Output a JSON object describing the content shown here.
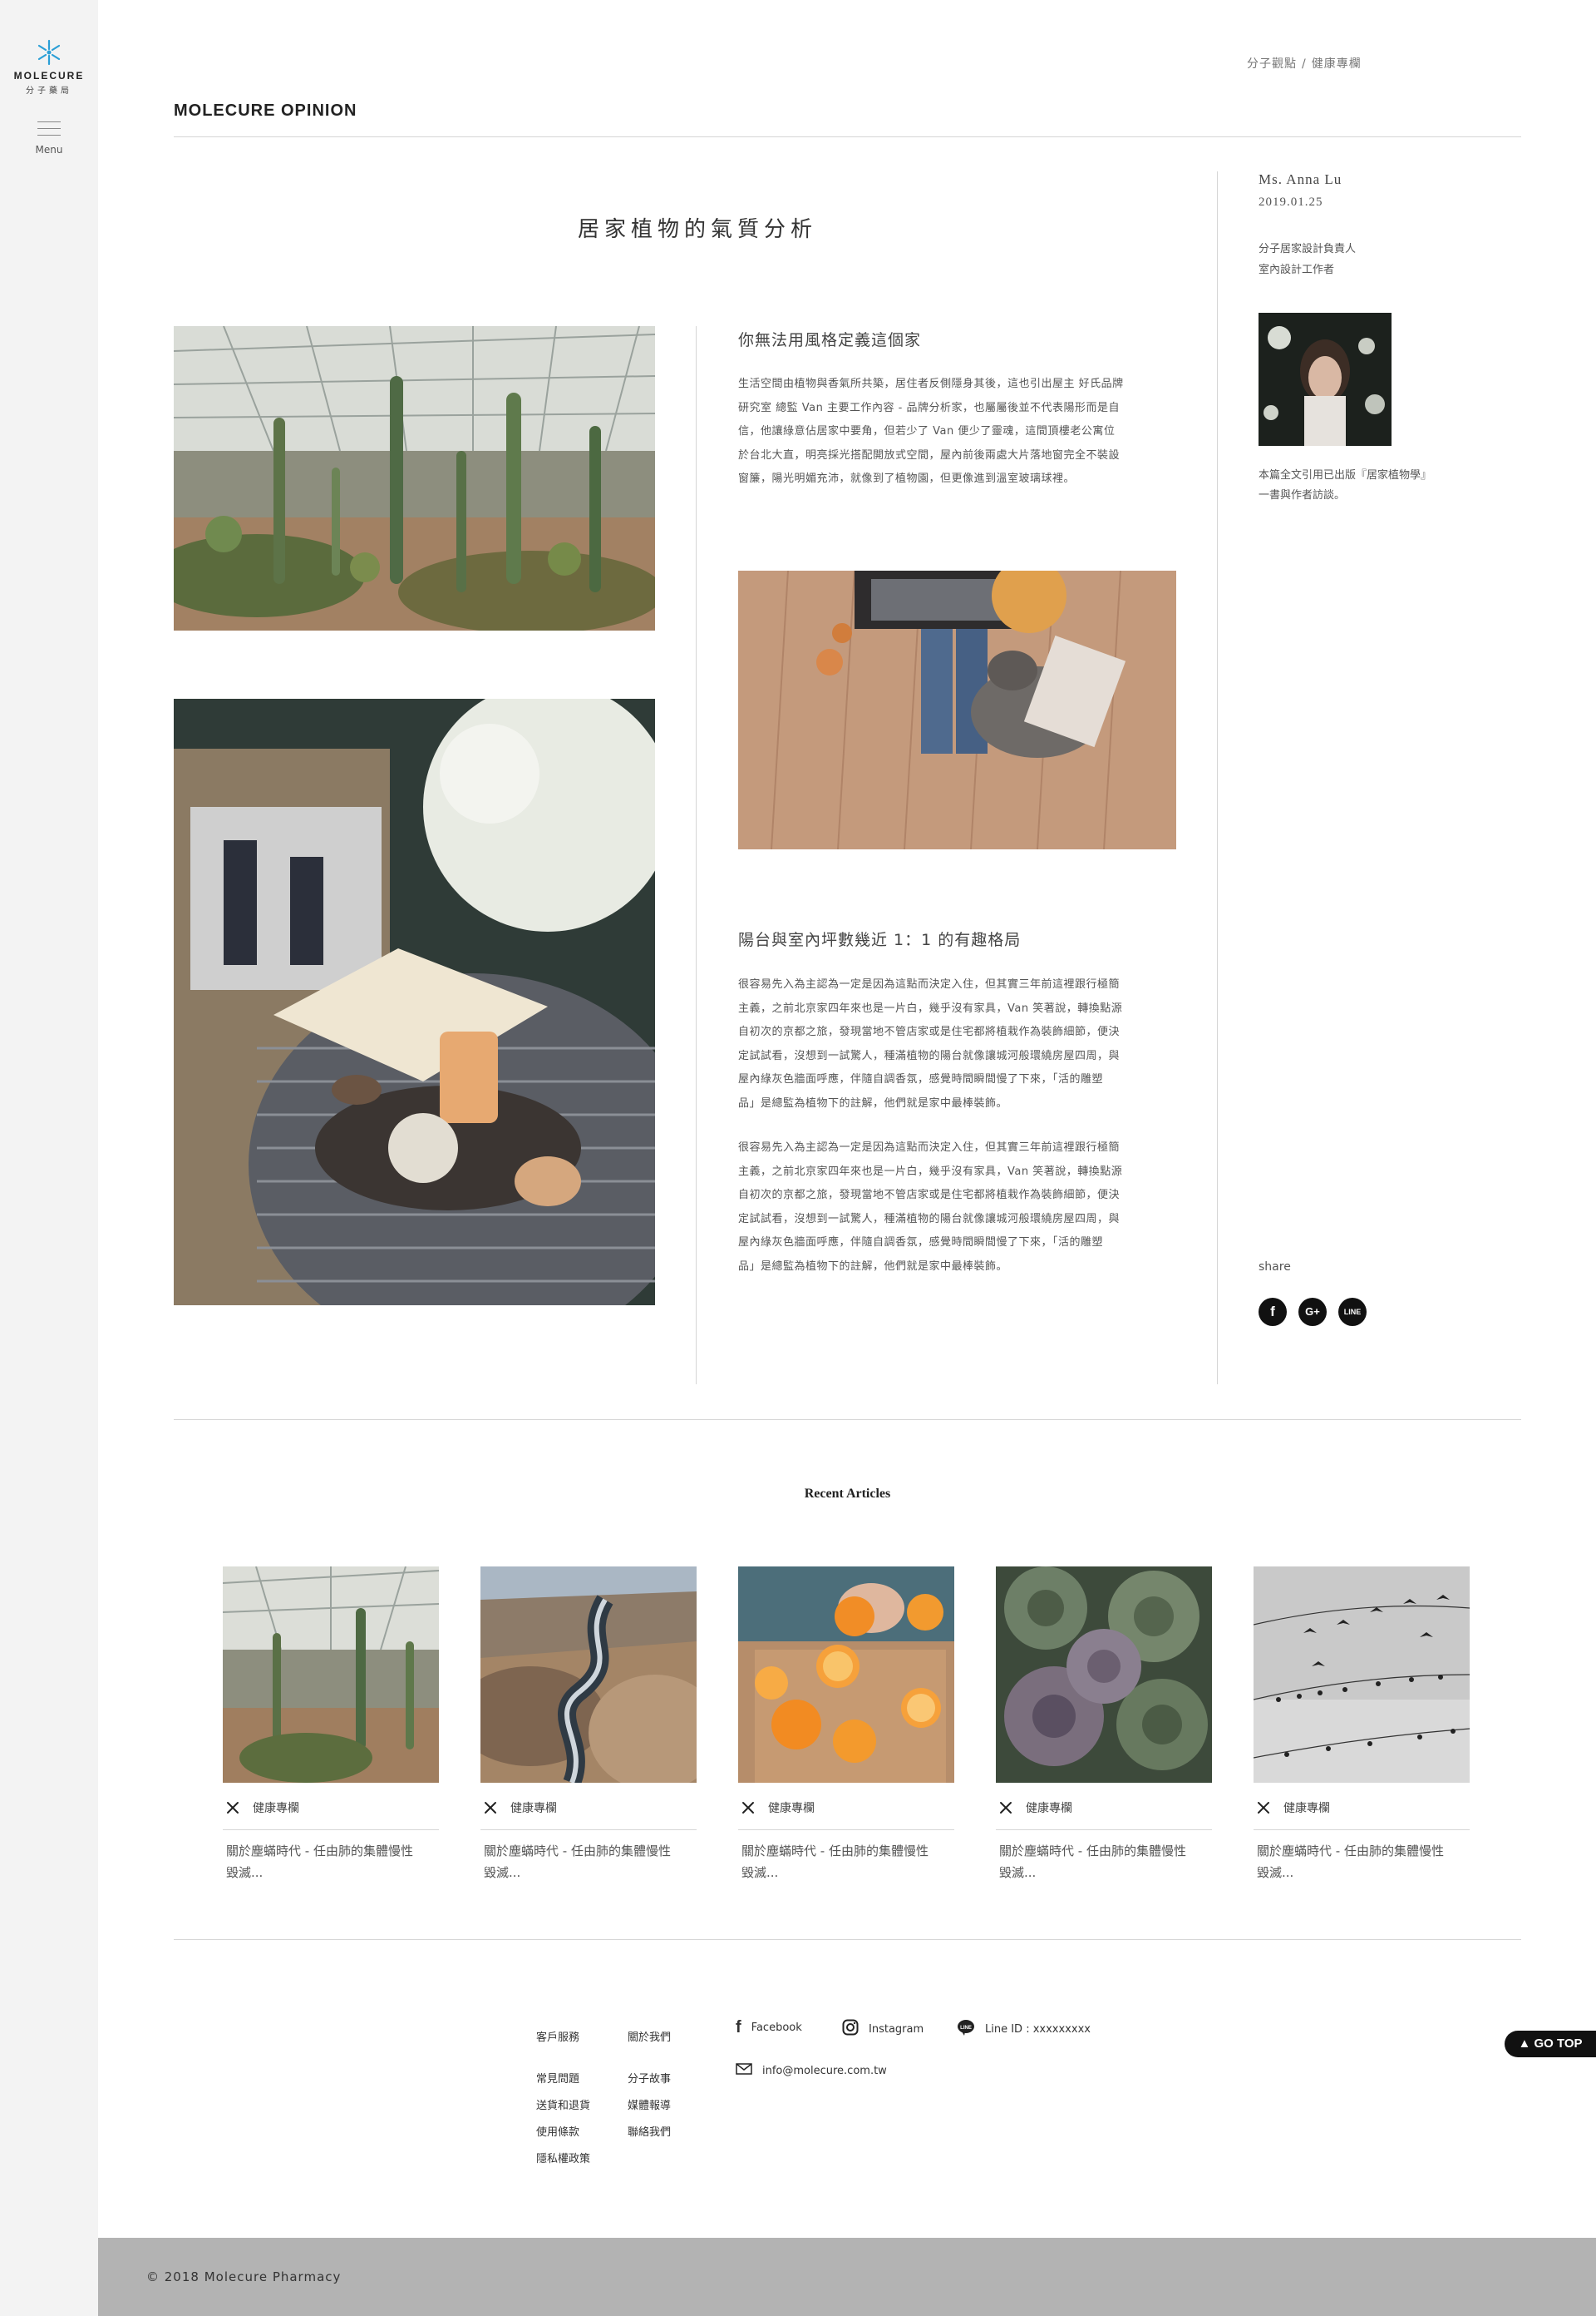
{
  "sidebar": {
    "logo_name": "MOLECURE",
    "logo_sub": "分子藥局",
    "menu_label": "Menu"
  },
  "breadcrumb": [
    "分子觀點",
    "/",
    "健康專欄"
  ],
  "site_title": "MOLECURE OPINION",
  "article": {
    "title": "居家植物的氣質分析",
    "section1": {
      "heading": "你無法用風格定義這個家",
      "lines": [
        "生活空間由植物與香氣所共築，居住者反側隱身其後，這也引出屋主 好氏品牌",
        "研究室 總監 Van 主要工作內容 - 品牌分析家，也屬屬後並不代表陽形而是自",
        "信，他讓綠意佔居家中要角，但若少了 Van 便少了靈魂，這間頂樓老公寓位",
        "於台北大直，明亮採光搭配開放式空間，屋內前後兩處大片落地窗完全不裝設",
        "窗簾，陽光明媚充沛，就像到了植物園，但更像進到溫室玻璃球裡。"
      ]
    },
    "section2": {
      "heading": "陽台與室內坪數幾近 1：1 的有趣格局",
      "para1": [
        "很容易先入為主認為一定是因為這點而決定入住，但其實三年前這裡跟行極簡",
        "主義，之前北京家四年來也是一片白，幾乎沒有家具，Van 笑著說，轉換點源",
        "自初次的京都之旅，發現當地不管店家或是住宅都將植栽作為裝飾細節，便決",
        "定試試看，沒想到一試驚人，種滿植物的陽台就像讓城河般環繞房屋四周，與",
        "屋內綠灰色牆面呼應，伴隨自調香氛，感覺時間瞬間慢了下來，「活的雕塑",
        "品」是總監為植物下的註解，他們就是家中最棒裝飾。"
      ],
      "para2": [
        "很容易先入為主認為一定是因為這點而決定入住，但其實三年前這裡跟行極簡",
        "主義，之前北京家四年來也是一片白，幾乎沒有家具，Van 笑著說，轉換點源",
        "自初次的京都之旅，發現當地不管店家或是住宅都將植栽作為裝飾細節，便決",
        "定試試看，沒想到一試驚人，種滿植物的陽台就像讓城河般環繞房屋四周，與",
        "屋內綠灰色牆面呼應，伴隨自調香氛，感覺時間瞬間慢了下來，「活的雕塑",
        "品」是總監為植物下的註解，他們就是家中最棒裝飾。"
      ]
    }
  },
  "author": {
    "name": "Ms. Anna Lu",
    "date": "2019.01.25",
    "role_lines": [
      "分子居家設計負責人",
      "室內設計工作者"
    ],
    "note_lines": [
      "本篇全文引用已出版『居家植物學』",
      "一書與作者訪談。"
    ],
    "share_label": "share",
    "share_icons": [
      {
        "name": "facebook-icon",
        "glyph": "f"
      },
      {
        "name": "google-plus-icon",
        "glyph": "G+"
      },
      {
        "name": "line-icon",
        "glyph": "LINE"
      }
    ]
  },
  "recent": {
    "title": "Recent Articles",
    "items": [
      {
        "category": "健康專欄",
        "title_lines": [
          "關於塵蟎時代 - 任由肺的集體慢性",
          "毀滅..."
        ]
      },
      {
        "category": "健康專欄",
        "title_lines": [
          "關於塵蟎時代 - 任由肺的集體慢性",
          "毀滅..."
        ]
      },
      {
        "category": "健康專欄",
        "title_lines": [
          "關於塵蟎時代 - 任由肺的集體慢性",
          "毀滅..."
        ]
      },
      {
        "category": "健康專欄",
        "title_lines": [
          "關於塵蟎時代 - 任由肺的集體慢性",
          "毀滅..."
        ]
      },
      {
        "category": "健康專欄",
        "title_lines": [
          "關於塵蟎時代 - 任由肺的集體慢性",
          "毀滅..."
        ]
      }
    ]
  },
  "footer": {
    "col1": {
      "heading": "客戶服務",
      "links": [
        "常見問題",
        "送貨和退貨",
        "使用條款",
        "隱私權政策"
      ]
    },
    "col2": {
      "heading": "關於我們",
      "links": [
        "分子故事",
        "媒體報導",
        "聯絡我們"
      ]
    },
    "facebook": "Facebook",
    "instagram": "Instagram",
    "line_id": "Line ID : xxxxxxxxx",
    "email": "info@molecure.com.tw",
    "go_top": "▲ GO TOP",
    "copyright": "© 2018 Molecure Pharmacy"
  },
  "colors": {
    "accent": "#2b9fd6",
    "sidebar_bg": "#f3f3f3",
    "footer_bar": "#b3b3b3"
  }
}
